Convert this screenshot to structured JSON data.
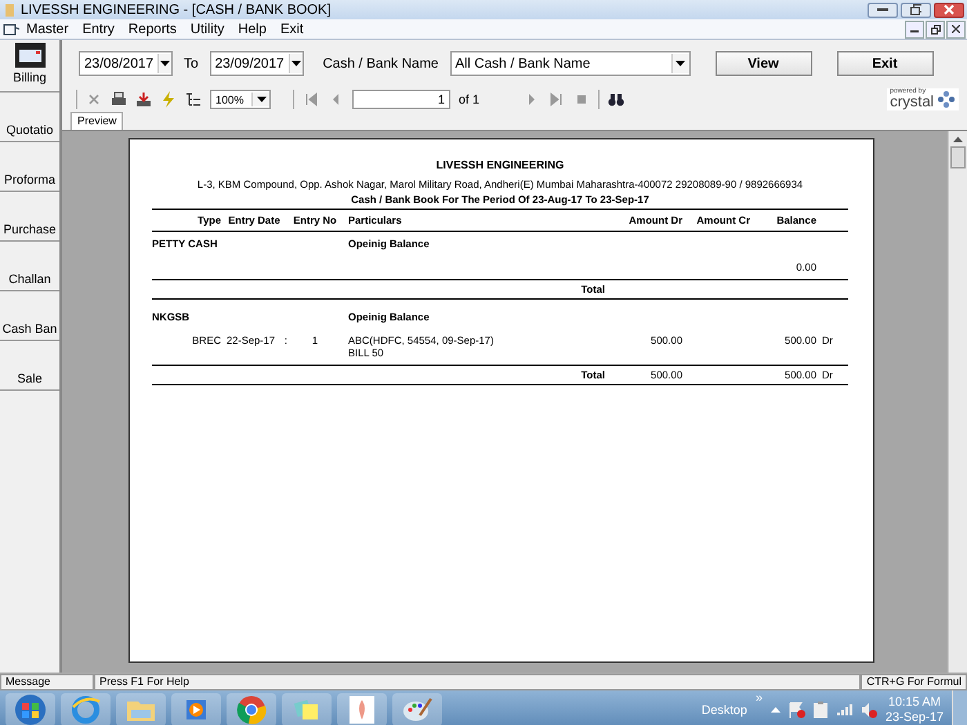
{
  "window": {
    "title": "LIVESSH ENGINEERING - [CASH / BANK BOOK]"
  },
  "menu": [
    "Master",
    "Entry",
    "Reports",
    "Utility",
    "Help",
    "Exit"
  ],
  "sidebar": {
    "items": [
      {
        "label": "Billing",
        "kind": "icon"
      },
      {
        "label": "Quotatio",
        "kind": "text"
      },
      {
        "label": "Proforma",
        "kind": "text"
      },
      {
        "label": "Purchase",
        "kind": "text"
      },
      {
        "label": "Challan",
        "kind": "text"
      },
      {
        "label": "Cash Ban",
        "kind": "text"
      },
      {
        "label": "Sale",
        "kind": "text"
      }
    ]
  },
  "filter": {
    "from_date": "23/08/2017",
    "to_label": "To",
    "to_date": "23/09/2017",
    "bank_label": "Cash / Bank Name",
    "bank_value": "All Cash / Bank Name",
    "buttons": [
      "View",
      "Exit"
    ]
  },
  "viewer": {
    "zoom": "100%",
    "page": "1",
    "page_of": "of 1",
    "tab": "Preview",
    "brand_small": "powered by",
    "brand": "crystal"
  },
  "report": {
    "company": "LIVESSH ENGINEERING",
    "address": "L-3, KBM Compound, Opp. Ashok Nagar, Marol Military Road, Andheri(E) Mumbai Maharashtra-400072 29208089-90 /  9892666934",
    "period": "Cash / Bank Book For The Period Of 23-Aug-17 To 23-Sep-17",
    "columns": [
      "Type",
      "Entry Date",
      "Entry No",
      "Particulars",
      "Amount Dr",
      "Amount Cr",
      "Balance"
    ],
    "rows": [
      {
        "kind": "group",
        "name": "PETTY CASH",
        "particulars": "Opeinig Balance"
      },
      {
        "kind": "balance",
        "balance": "0.00"
      },
      {
        "kind": "total",
        "label": "Total"
      },
      {
        "kind": "group",
        "name": "NKGSB",
        "particulars": "Opeinig Balance"
      },
      {
        "kind": "entry",
        "type": "BREC",
        "date": "22-Sep-17",
        "sep": ":",
        "entry_no": "1",
        "particulars": [
          "ABC(HDFC, 54554, 09-Sep-17)",
          "BILL 50"
        ],
        "dr": "500.00",
        "balance": "500.00",
        "side": "Dr"
      },
      {
        "kind": "total",
        "label": "Total",
        "dr": "500.00",
        "balance": "500.00",
        "side": "Dr"
      }
    ]
  },
  "status_bar": [
    "Message",
    "Press F1 For Help",
    "CTR+G For Formul"
  ],
  "taskbar": {
    "desktop": "Desktop",
    "more": "»",
    "time": "10:15 AM",
    "date": "23-Sep-17"
  }
}
